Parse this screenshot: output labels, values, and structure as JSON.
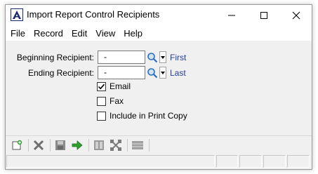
{
  "window": {
    "title": "Import Report Control Recipients",
    "brand_color": "#1b2a6b"
  },
  "menu": {
    "items": [
      {
        "label": "File"
      },
      {
        "label": "Record"
      },
      {
        "label": "Edit"
      },
      {
        "label": "View"
      },
      {
        "label": "Help"
      }
    ]
  },
  "form": {
    "beginning": {
      "label": "Beginning Recipient:",
      "value": "-",
      "link": "First"
    },
    "ending": {
      "label": "Ending Recipient:",
      "value": "-",
      "link": "Last"
    },
    "checks": [
      {
        "label": "Email",
        "checked": true
      },
      {
        "label": "Fax",
        "checked": false
      },
      {
        "label": "Include in Print Copy",
        "checked": false
      }
    ],
    "link_color": "#1f3f99"
  },
  "toolbar": {
    "icons": [
      "new-record-icon",
      "delete-icon",
      "save-icon",
      "go-arrow-icon",
      "print-preview-icon",
      "settings-icon",
      "list-icon"
    ]
  }
}
